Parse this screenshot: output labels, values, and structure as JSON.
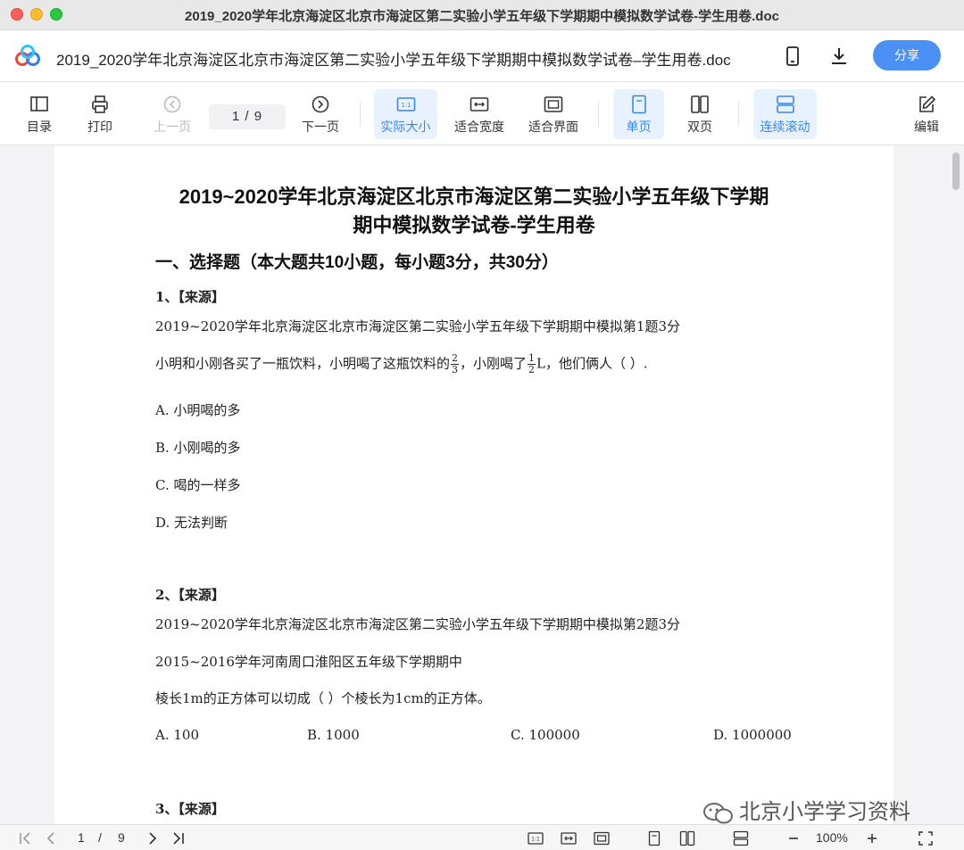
{
  "window": {
    "title": "2019_2020学年北京海淀区北京市海淀区第二实验小学五年级下学期期中模拟数学试卷-学生用卷.doc"
  },
  "header": {
    "doc_title": "2019_2020学年北京海淀区北京市海淀区第二实验小学五年级下学期期中模拟数学试卷–学生用卷.doc",
    "share_label": "分享"
  },
  "toolbar": {
    "toc": "目录",
    "print": "打印",
    "prev": "上一页",
    "page_indicator": "1 / 9",
    "next": "下一页",
    "actual_size": "实际大小",
    "fit_width": "适合宽度",
    "fit_screen": "适合界面",
    "single_page": "单页",
    "double_page": "双页",
    "continuous": "连续滚动",
    "edit": "编辑"
  },
  "document": {
    "title_line1": "2019~2020学年北京海淀区北京市海淀区第二实验小学五年级下学期",
    "title_line2": "期中模拟数学试卷-学生用卷",
    "section1": "一、选择题（本大题共10小题，每小题3分，共30分）",
    "q1": {
      "number": "1、【来源】",
      "source": "2019~2020学年北京海淀区北京市海淀区第二实验小学五年级下学期期中模拟第1题3分",
      "stem_a": "小明和小刚各买了一瓶饮料，小明喝了这瓶饮料的",
      "frac1_num": "2",
      "frac1_den": "3",
      "stem_b": "，小刚喝了",
      "frac2_num": "1",
      "frac2_den": "2",
      "stem_c": "L，他们俩人（    ）.",
      "options": [
        "A.  小明喝的多",
        "B.  小刚喝的多",
        "C.  喝的一样多",
        "D.  无法判断"
      ]
    },
    "q2": {
      "number": "2、【来源】",
      "source": "2019~2020学年北京海淀区北京市海淀区第二实验小学五年级下学期期中模拟第2题3分",
      "source2": "2015~2016学年河南周口淮阳区五年级下学期期中",
      "stem": "棱长1m的正方体可以切成（        ）个棱长为1cm的正方体。",
      "options": [
        "A.  100",
        "B.  1000",
        "C.  100000",
        "D.  1000000"
      ]
    },
    "q3": {
      "number": "3、【来源】"
    }
  },
  "watermark": "北京小学学习资料",
  "statusbar": {
    "page_current": "1",
    "page_sep": "/",
    "page_total": "9",
    "zoom": "100%"
  },
  "colors": {
    "accent": "#4a90f5",
    "active_bg": "#e8f1fe",
    "active_text": "#3a86f0"
  }
}
